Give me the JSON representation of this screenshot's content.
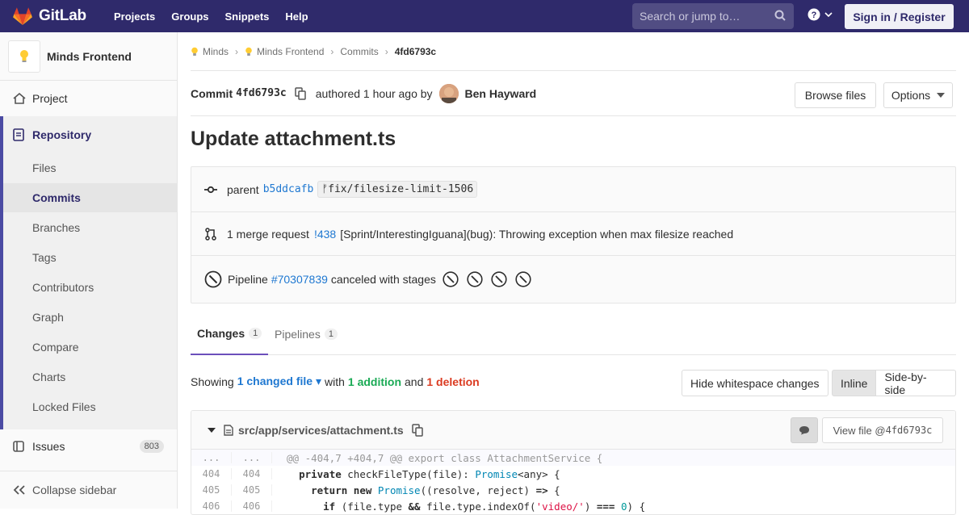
{
  "navbar": {
    "brand": "GitLab",
    "links": [
      "Projects",
      "Groups",
      "Snippets",
      "Help"
    ],
    "search_placeholder": "Search or jump to…",
    "signin": "Sign in / Register"
  },
  "sidebar": {
    "project_name": "Minds Frontend",
    "project": "Project",
    "repository": "Repository",
    "repo_items": [
      "Files",
      "Commits",
      "Branches",
      "Tags",
      "Contributors",
      "Graph",
      "Compare",
      "Charts",
      "Locked Files"
    ],
    "active_item": "Commits",
    "issues": "Issues",
    "issues_count": "803",
    "collapse": "Collapse sidebar"
  },
  "breadcrumb": {
    "items": [
      "Minds",
      "Minds Frontend",
      "Commits"
    ],
    "current": "4fd6793c"
  },
  "commit": {
    "label": "Commit",
    "sha": "4fd6793c",
    "authored": "authored 1 hour ago by",
    "author": "Ben Hayward",
    "browse_files": "Browse files",
    "options": "Options",
    "title": "Update attachment.ts",
    "parent_label": "parent",
    "parent_sha": "b5ddcafb",
    "branch": "fix/filesize-limit-1506",
    "mr_count_text": "1 merge request",
    "mr_id": "!438",
    "mr_title": "[Sprint/InterestingIguana](bug): Throwing exception when max filesize reached",
    "pipeline_label": "Pipeline",
    "pipeline_id": "#70307839",
    "pipeline_status": "canceled with stages",
    "stages": [
      "canceled",
      "canceled",
      "canceled",
      "canceled"
    ]
  },
  "tabs": [
    {
      "label": "Changes",
      "count": "1"
    },
    {
      "label": "Pipelines",
      "count": "1"
    }
  ],
  "diff_summary": {
    "showing": "Showing",
    "changed": "1 changed file",
    "with": "with",
    "additions": "1 addition",
    "and": "and",
    "deletions": "1 deletion",
    "hide_whitespace": "Hide whitespace changes",
    "inline": "Inline",
    "side_by_side": "Side-by-side"
  },
  "file": {
    "path": "src/app/services/attachment.ts",
    "view_file": "View file @ ",
    "view_sha": "4fd6793c",
    "hunk": "@@ -404,7 +404,7 @@ export class AttachmentService {",
    "lines": [
      {
        "old": "404",
        "new": "404"
      },
      {
        "old": "405",
        "new": "405"
      },
      {
        "old": "406",
        "new": "406"
      }
    ],
    "ellipsis": "..."
  },
  "colors": {
    "navbar": "#2f2a6b",
    "link": "#1f78d1",
    "addition": "#1aaa55",
    "deletion": "#db3b21",
    "active_tab": "#6b4fbb"
  }
}
